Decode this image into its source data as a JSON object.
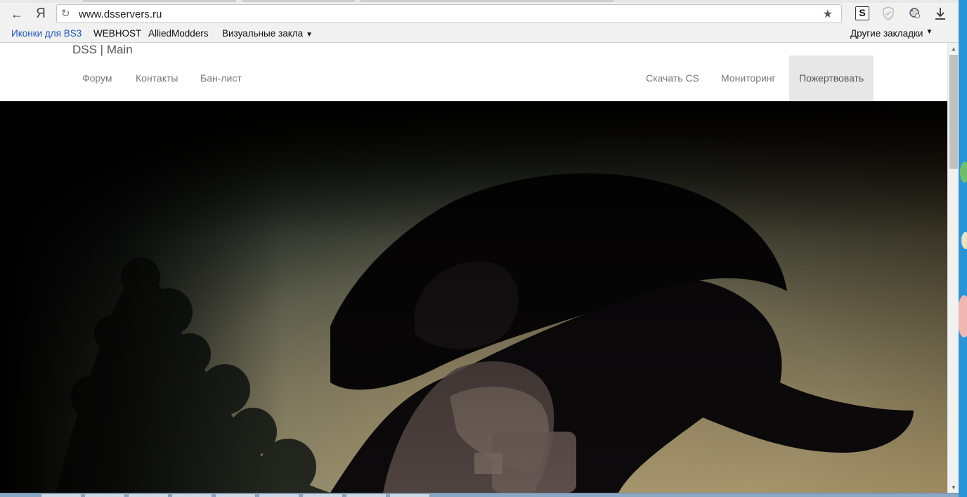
{
  "browser": {
    "address_url": "www.dsservers.ru",
    "yandex_label": "Я",
    "extension_s_label": "S",
    "bookmarks": [
      {
        "label": "Иконки для BS3"
      },
      {
        "label": "WEBHOST"
      },
      {
        "label": "AlliedModders"
      },
      {
        "label": "Визуальные закла"
      }
    ],
    "other_bookmarks": "Другие закладки"
  },
  "site": {
    "brand": "DSS | Main",
    "nav_left": [
      "Форум",
      "Контакты",
      "Бан-лист"
    ],
    "nav_right": [
      "Скачать CS",
      "Мониторинг"
    ],
    "nav_active": "Пожертвовать"
  },
  "colors": {
    "bookmark_link": "#2257b4",
    "nav_active_bg": "#e7e7e7",
    "nav_text": "#777777",
    "hero_sky": "#9aa890",
    "hero_dark": "#000000"
  }
}
